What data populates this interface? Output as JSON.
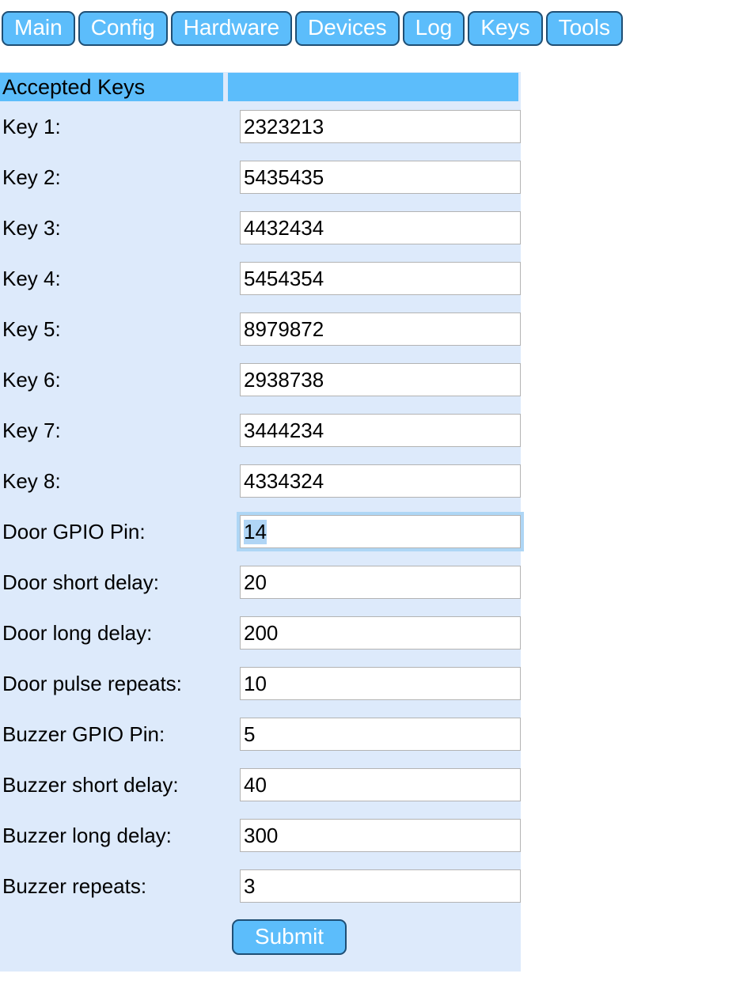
{
  "nav": {
    "tabs": [
      {
        "label": "Main"
      },
      {
        "label": "Config"
      },
      {
        "label": "Hardware"
      },
      {
        "label": "Devices"
      },
      {
        "label": "Log"
      },
      {
        "label": "Keys"
      },
      {
        "label": "Tools"
      }
    ]
  },
  "table": {
    "header": {
      "title": "Accepted Keys",
      "value_column": ""
    },
    "rows": [
      {
        "label": "Key 1:",
        "value": "2323213",
        "focused": false
      },
      {
        "label": "Key 2:",
        "value": "5435435",
        "focused": false
      },
      {
        "label": "Key 3:",
        "value": "4432434",
        "focused": false
      },
      {
        "label": "Key 4:",
        "value": "5454354",
        "focused": false
      },
      {
        "label": "Key 5:",
        "value": "8979872",
        "focused": false
      },
      {
        "label": "Key 6:",
        "value": "2938738",
        "focused": false
      },
      {
        "label": "Key 7:",
        "value": "3444234",
        "focused": false
      },
      {
        "label": "Key 8:",
        "value": "4334324",
        "focused": false
      },
      {
        "label": "Door GPIO Pin:",
        "value": "14",
        "focused": true
      },
      {
        "label": "Door short delay:",
        "value": "20",
        "focused": false
      },
      {
        "label": "Door long delay:",
        "value": "200",
        "focused": false
      },
      {
        "label": "Door pulse repeats:",
        "value": "10",
        "focused": false
      },
      {
        "label": "Buzzer GPIO Pin:",
        "value": "5",
        "focused": false
      },
      {
        "label": "Buzzer short delay:",
        "value": "40",
        "focused": false
      },
      {
        "label": "Buzzer long delay:",
        "value": "300",
        "focused": false
      },
      {
        "label": "Buzzer repeats:",
        "value": "3",
        "focused": false
      }
    ],
    "submit_label": "Submit"
  },
  "colors": {
    "accent_blue": "#5cbdfb",
    "border_navy": "#1f4f75",
    "panel_background": "#ddeafb",
    "focus_ring": "#aed6f5",
    "selection": "#b0d5f5",
    "input_border": "#b3b3b3",
    "page_background": "#ffffff"
  }
}
